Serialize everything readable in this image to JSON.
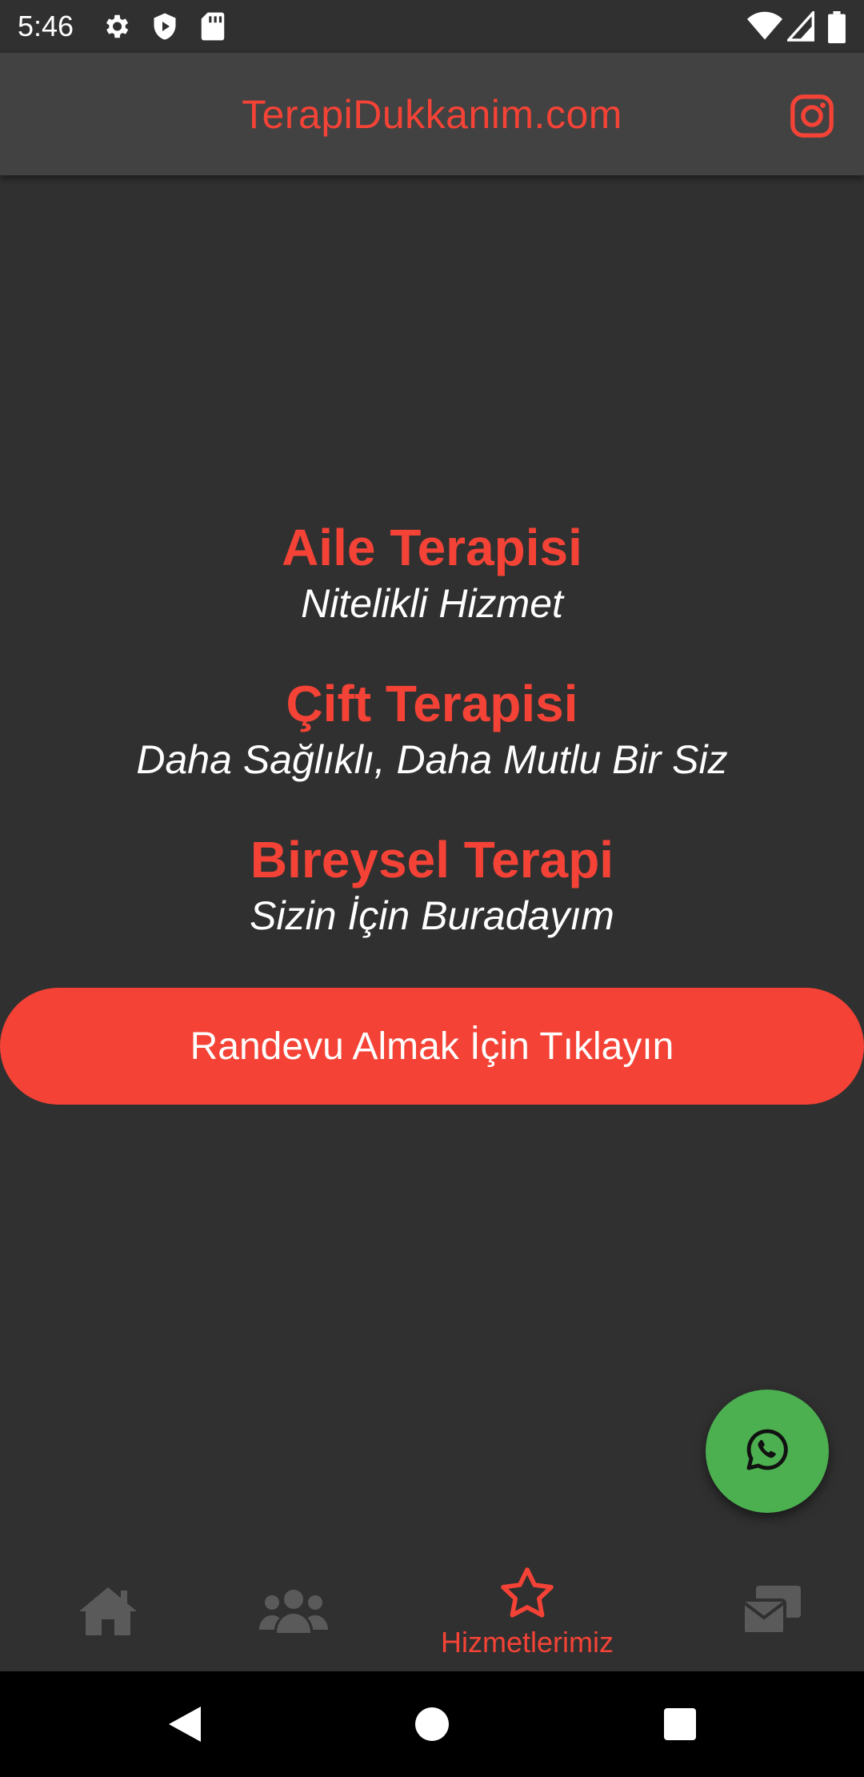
{
  "status_bar": {
    "time": "5:46",
    "icons_left": [
      "gear-icon",
      "shield-play-icon",
      "sd-card-icon"
    ],
    "icons_right": [
      "wifi-icon",
      "signal-icon",
      "battery-icon"
    ]
  },
  "app_bar": {
    "title": "TerapiDukkanim.com",
    "right_icon": "instagram-icon"
  },
  "services": [
    {
      "title": "Aile Terapisi",
      "subtitle": "Nitelikli Hizmet"
    },
    {
      "title": "Çift Terapisi",
      "subtitle": "Daha Sağlıklı, Daha Mutlu Bir Siz"
    },
    {
      "title": "Bireysel Terapi",
      "subtitle": "Sizin İçin Buradayım"
    }
  ],
  "cta": {
    "label": "Randevu Almak İçin Tıklayın"
  },
  "fab": {
    "icon": "whatsapp-icon"
  },
  "bottom_nav": {
    "items": [
      {
        "icon": "home-icon",
        "label": ""
      },
      {
        "icon": "users-icon",
        "label": ""
      },
      {
        "icon": "star-icon",
        "label": "Hizmetlerimiz",
        "active": true
      },
      {
        "icon": "mail-icon",
        "label": ""
      }
    ]
  },
  "colors": {
    "accent": "#f44336",
    "background": "#303030",
    "app_bar": "#424242",
    "whatsapp": "#4caf50",
    "inactive_icon": "#5a5a5a"
  }
}
